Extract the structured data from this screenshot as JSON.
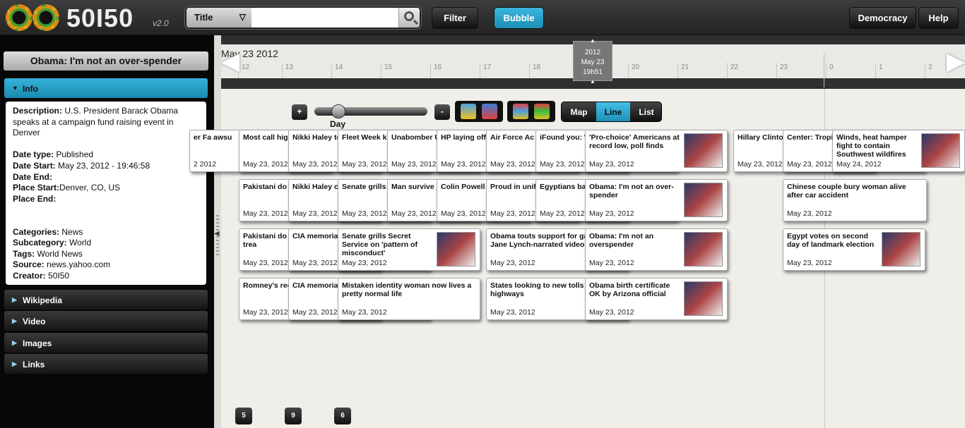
{
  "app": {
    "logo_text": "50I50",
    "version": "v2.0"
  },
  "search": {
    "type_label": "Title",
    "value": ""
  },
  "toolbar": {
    "filter_label": "Filter",
    "bubble_label": "Bubble",
    "democracy_label": "Democracy",
    "help_label": "Help"
  },
  "sidebar": {
    "title": "Obama: I'm not an over-spender",
    "sections": [
      {
        "label": "Info"
      },
      {
        "label": "Wikipedia"
      },
      {
        "label": "Video"
      },
      {
        "label": "Images"
      },
      {
        "label": "Links"
      }
    ],
    "info": {
      "description_label": "Description:",
      "description": "U.S. President Barack Obama speaks at a campaign fund raising event in Denver",
      "date_type_label": "Date type:",
      "date_type": "Published",
      "date_start_label": "Date Start:",
      "date_start": "May 23, 2012 - 19:46:58",
      "date_end_label": "Date End:",
      "date_end": "",
      "place_start_label": "Place Start:",
      "place_start": "Denver, CO, US",
      "place_end_label": "Place End:",
      "place_end": "",
      "categories_label": "Categories:",
      "categories": "News",
      "subcategory_label": "Subcategory:",
      "subcategory": "World",
      "tags_label": "Tags:",
      "tags": "World News",
      "source_label": "Source:",
      "source": "news.yahoo.com",
      "creator_label": "Creator:",
      "creator": "50I50"
    }
  },
  "timeline": {
    "date_label": "May 23 2012",
    "ticks": [
      "12",
      "13",
      "14",
      "15",
      "16",
      "17",
      "18",
      "19",
      "20",
      "21",
      "22",
      "23",
      "0",
      "1",
      "2"
    ],
    "cursor": {
      "year": "2012",
      "date": "May 23",
      "time": "19h51"
    }
  },
  "controls": {
    "zoom_in": "+",
    "zoom_out": "-",
    "zoom_level": "Day",
    "views": [
      "Map",
      "Line",
      "List"
    ],
    "active_view": "Line",
    "colors": {
      "accent": "#2aa6d0"
    }
  },
  "cards": [
    {
      "title": "er Fa awsu",
      "date": "2 2012"
    },
    {
      "title": "Most call hig evaluating ca",
      "date": "May 23, 2012"
    },
    {
      "title": "Nikki Haley to union leader",
      "date": "May 23, 2012"
    },
    {
      "title": "Fleet Week k",
      "date": "May 23, 2012"
    },
    {
      "title": "Unabomber U Status in Har Magazine",
      "date": "May 23, 2012"
    },
    {
      "title": "HP laying off workers in re",
      "date": "May 23, 2012"
    },
    {
      "title": "Air Force Ac graduates fir cadets",
      "date": "May 23, 2012"
    },
    {
      "title": "iFound you: W from her stole",
      "date": "May 23, 2012"
    },
    {
      "title": "'Pro-choice' Americans at record low, poll finds",
      "date": "May 23, 2012"
    },
    {
      "title": "Hillary Clinto hack al-Qa",
      "date": "May 23, 2012"
    },
    {
      "title": "Center: Tropi a hurricane",
      "date": "May 23, 2012"
    },
    {
      "title": "Winds, heat hamper fight to contain Southwest wildfires",
      "date": "May 24, 2012"
    },
    {
      "title": "Pakistani do Osama bin L",
      "date": "May 23, 2012"
    },
    {
      "title": "Nikki Haley c pinata bashin",
      "date": "May 23, 2012"
    },
    {
      "title": "Senate grills Service on ' misconduct'",
      "date": "May 23, 2012"
    },
    {
      "title": "Man survive jump withou",
      "date": "May 23, 2012"
    },
    {
      "title": "Colin Powell problem' with marriage",
      "date": "May 23, 2012"
    },
    {
      "title": "Proud in unif graduates ga",
      "date": "May 23, 2012"
    },
    {
      "title": "Egyptians ba to pick presid",
      "date": "May 23, 2012"
    },
    {
      "title": "Obama: I'm not an over-spender",
      "date": "May 23, 2012"
    },
    {
      "title": "Chinese couple bury woman alive after car accident",
      "date": "May 23, 2012"
    },
    {
      "title": "Pakistani do helped CIA fi jailed for trea",
      "date": "May 23, 2012"
    },
    {
      "title": "CIA memoria identities of f officers",
      "date": "May 23, 2012"
    },
    {
      "title": "Senate grills Secret Service on 'pattern of misconduct'",
      "date": "May 23, 2012"
    },
    {
      "title": "Obama touts support for gay rights in Jane Lynch-narrated video",
      "date": "May 23, 2012"
    },
    {
      "title": "Obama: I'm not an overspender",
      "date": "May 23, 2012"
    },
    {
      "title": "Egypt votes on second day of landmark election",
      "date": "May 23, 2012"
    },
    {
      "title": "Romney's rec Capital: Does",
      "date": "May 23, 2012"
    },
    {
      "title": "CIA memoria IDs of fallen officers",
      "date": "May 23, 2012"
    },
    {
      "title": "Mistaken identity woman now lives a pretty normal life",
      "date": "May 23, 2012"
    },
    {
      "title": "States looking to new tolls to pay for highways",
      "date": "May 23, 2012"
    },
    {
      "title": "Obama birth certificate OK by Arizona official",
      "date": "May 23, 2012"
    }
  ],
  "pages": [
    "5",
    "9",
    "6"
  ]
}
